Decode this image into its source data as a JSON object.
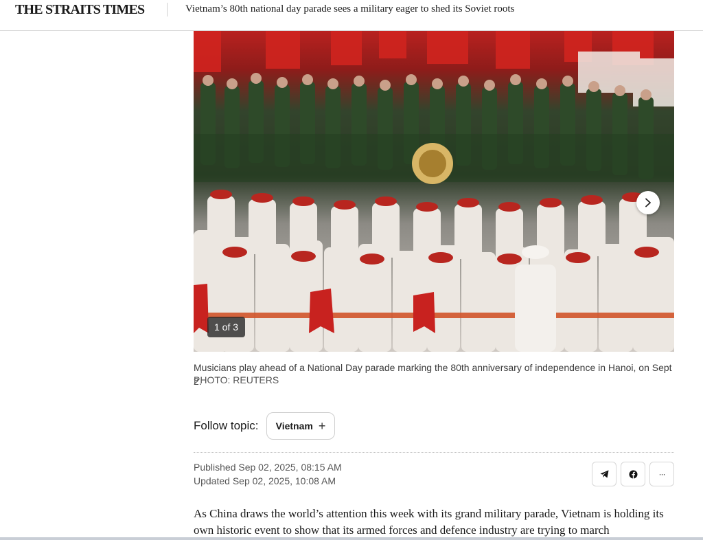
{
  "header": {
    "logo_text": "THE STRAITS TIMES",
    "headline": "Vietnam’s 80th national day parade sees a military eager to shed its Soviet roots"
  },
  "gallery": {
    "counter": "1 of 3",
    "next_icon": "chevron-right-icon",
    "caption": "Musicians play ahead of a National Day parade marking the 80th anniversary of independence in Hanoi, on Sept 2.",
    "credit": "PHOTO: REUTERS"
  },
  "follow": {
    "label": "Follow topic:",
    "topic": "Vietnam",
    "plus": "+"
  },
  "meta": {
    "published": "Published Sep 02, 2025, 08:15 AM",
    "updated": "Updated Sep 02, 2025, 10:08 AM"
  },
  "share": {
    "telegram_icon": "telegram-icon",
    "facebook_icon": "facebook-icon",
    "more_label": "···"
  },
  "article": {
    "paragraph": "As China draws the world’s attention this week with its grand military parade, Vietnam is holding its own historic event to show that its armed forces and defence industry are trying to march"
  },
  "colors": {
    "flag_red": "#c8221f",
    "uniform_green": "#2f4a2a",
    "uniform_white": "#eeeae6",
    "brass": "#d6b25a"
  }
}
